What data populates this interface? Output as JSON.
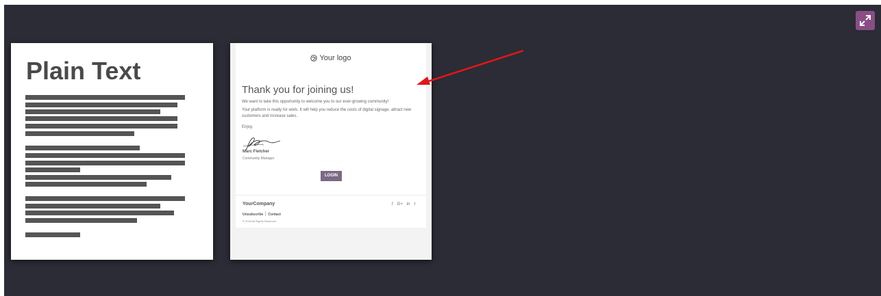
{
  "templates": {
    "plain_text": {
      "title": "Plain Text"
    },
    "email": {
      "logo_text": "Your logo",
      "heading": "Thank you for joining us!",
      "paragraph1": "We want to take this opportunity to welcome you to our ever-growing community!",
      "paragraph2": "Your platform is ready for work. It will help you reduce the costs of digital signage, attract new customers and increase sales.",
      "closing": "Enjoy,",
      "signer_name": "Marc Fletcher",
      "signer_role": "Community Manager",
      "login_label": "LOGIN",
      "company_name": "YourCompany",
      "social": [
        "f",
        "G+",
        "in",
        "t"
      ],
      "unsubscribe_label": "Unsubscribe",
      "contact_label": "Contact",
      "copyright": "© 2018 All Rights Reserved"
    }
  },
  "colors": {
    "stage_bg": "#2b2c35",
    "expand_button": "#8a4e86",
    "login_button": "#7a6a85",
    "annotation_arrow": "#e0161b"
  },
  "icons": {
    "expand": "expand-arrows-icon",
    "logo": "logo-swirl-icon"
  }
}
